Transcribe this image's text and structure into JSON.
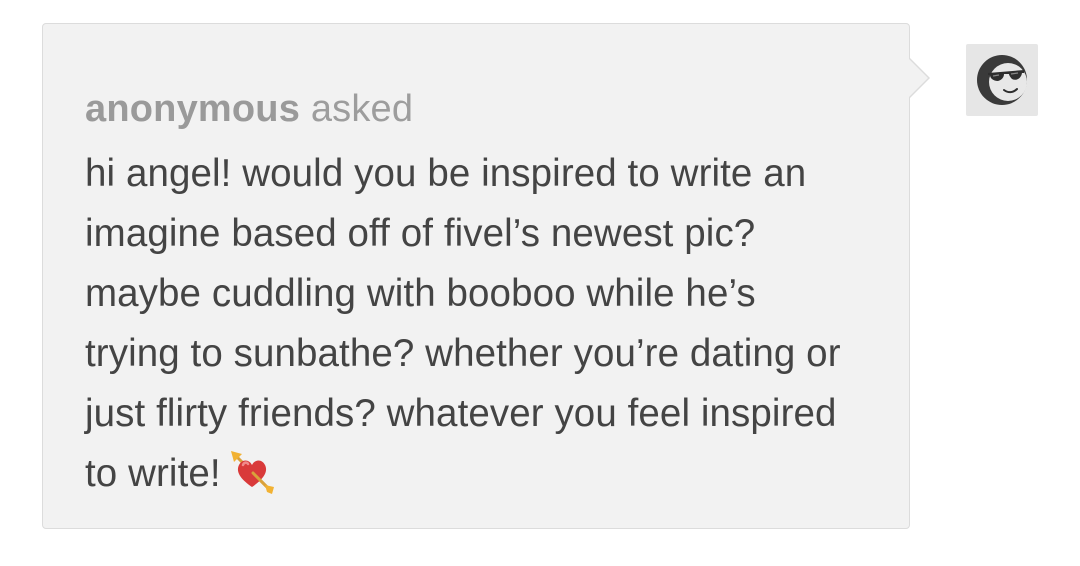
{
  "ask": {
    "asker": "anonymous",
    "verb": "asked",
    "body_lines": [
      "hi angel! would you be inspired to write an",
      "imagine based off of fivel’s newest pic?",
      "maybe cuddling with booboo while he’s",
      "trying to sunbathe? whether you’re dating or",
      "just flirty friends? whatever you feel inspired",
      "to write!"
    ],
    "emoji": "heart-with-arrow-icon"
  },
  "avatar": {
    "icon": "cool-face-sunglasses-icon"
  },
  "colors": {
    "card_background": "#f2f2f2",
    "card_border": "#dcdcdc",
    "header_text": "#999999",
    "body_text": "#444444"
  }
}
